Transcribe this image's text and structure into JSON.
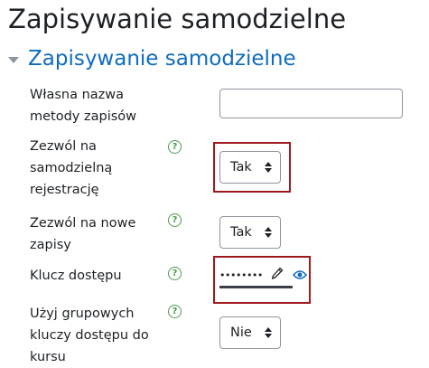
{
  "page": {
    "title": "Zapisywanie samodzielne"
  },
  "section": {
    "title": "Zapisywanie samodzielne",
    "toggle_icon": "chevron-down-icon"
  },
  "fields": {
    "method_name": {
      "label": "Własna nazwa metody zapisów",
      "value": "",
      "placeholder": ""
    },
    "allow_self_enrol": {
      "label": "Zezwól na samodzielną rejestrację",
      "help_icon": "help-icon",
      "selected": "Tak"
    },
    "allow_new_enrol": {
      "label": "Zezwól na nowe zapisy",
      "help_icon": "help-icon",
      "selected": "Tak"
    },
    "enrol_key": {
      "label": "Klucz dostępu",
      "help_icon": "help-icon",
      "masked_value": "••••••••",
      "edit_icon": "pencil-icon",
      "reveal_icon": "eye-icon"
    },
    "group_keys": {
      "label": "Użyj grupowych kluczy dostępu do kursu",
      "help_icon": "help-icon",
      "selected": "Nie"
    }
  },
  "help_glyph": "?",
  "colors": {
    "section_title": "#0f6cbf",
    "help_icon": "#4c9a4e",
    "highlight": "#a0191f",
    "text": "#1d2125"
  }
}
